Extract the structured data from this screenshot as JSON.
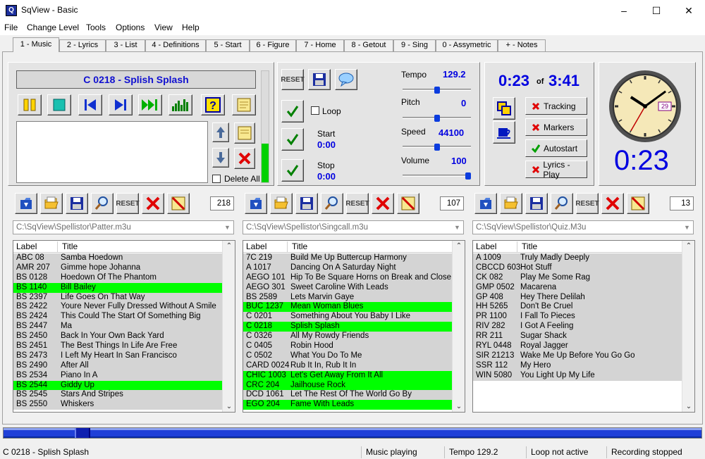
{
  "window": {
    "title": "SqView - Basic",
    "icon": "sqview-app-icon",
    "minimize": "–",
    "maximize": "☐",
    "close": "✕"
  },
  "menu": [
    "File",
    "Change Level",
    "Tools",
    "Options",
    "View",
    "Help"
  ],
  "tabs": [
    "1 - Music",
    "2 - Lyrics",
    "3 - List",
    "4 - Definitions",
    "5 - Start",
    "6 - Figure",
    "7 - Home",
    "8 - Getout",
    "9 - Sing",
    "0 - Assymetric",
    "+ - Notes"
  ],
  "player": {
    "song_title": "C 0218 - Splish Splash",
    "delete_all_label": "Delete All",
    "reset_label": "RESET",
    "loop_label": "Loop",
    "start_label": "Start",
    "start_value": "0:00",
    "stop_label": "Stop",
    "stop_value": "0:00",
    "level_fraction": 0.35
  },
  "controls": {
    "tempo_label": "Tempo",
    "tempo_value": "129.2",
    "tempo_fraction": 0.5,
    "pitch_label": "Pitch",
    "pitch_value": "0",
    "pitch_fraction": 0.5,
    "speed_label": "Speed",
    "speed_value": "44100",
    "speed_fraction": 0.5,
    "volume_label": "Volume",
    "volume_value": "100",
    "volume_fraction": 1.0
  },
  "time": {
    "elapsed": "0:23",
    "of": "of",
    "total": "3:41",
    "big_elapsed": "0:23",
    "clock_date": "29",
    "clock_hour": 10.1,
    "clock_minute": 9,
    "clock_second": 35
  },
  "side_buttons": {
    "tracking": "Tracking",
    "markers": "Markers",
    "autostart": "Autostart",
    "lyrics_play": "Lyrics - Play"
  },
  "lists": [
    {
      "count": "218",
      "path": "C:\\SqView\\Spellistor\\Patter.m3u",
      "col_label": "Label",
      "col_title": "Title",
      "rows": [
        {
          "label": "ABC 08",
          "title": "Samba Hoedown",
          "hl": false
        },
        {
          "label": "AMR 207",
          "title": "Gimme hope Johanna",
          "hl": false
        },
        {
          "label": "BS 0128",
          "title": "Hoedown Of The Phantom",
          "hl": false
        },
        {
          "label": "BS 1140",
          "title": "Bill Bailey",
          "hl": true
        },
        {
          "label": "BS 2397",
          "title": "Life Goes On That Way",
          "hl": false
        },
        {
          "label": "BS 2422",
          "title": "Youre Never Fully Dressed Without A Smile",
          "hl": false
        },
        {
          "label": "BS 2424",
          "title": "This Could The Start Of Something Big",
          "hl": false
        },
        {
          "label": "BS 2447",
          "title": "Ma",
          "hl": false
        },
        {
          "label": "BS 2450",
          "title": "Back In Your Own Back Yard",
          "hl": false
        },
        {
          "label": "BS 2451",
          "title": "The Best Things In Life Are Free",
          "hl": false
        },
        {
          "label": "BS 2473",
          "title": "I Left My Heart In San Francisco",
          "hl": false
        },
        {
          "label": "BS 2490",
          "title": "After All",
          "hl": false
        },
        {
          "label": "BS 2534",
          "title": "Piano In A",
          "hl": false
        },
        {
          "label": "BS 2544",
          "title": "Giddy Up",
          "hl": true
        },
        {
          "label": "BS 2545",
          "title": "Stars And Stripes",
          "hl": false
        },
        {
          "label": "BS 2550",
          "title": "Whiskers",
          "hl": false
        }
      ]
    },
    {
      "count": "107",
      "path": "C:\\SqView\\Spellistor\\Singcall.m3u",
      "col_label": "Label",
      "col_title": "Title",
      "rows": [
        {
          "label": "7C 219",
          "title": "Build Me Up Buttercup Harmony",
          "hl": false
        },
        {
          "label": "A 1017",
          "title": "Dancing On A Saturday Night",
          "hl": false
        },
        {
          "label": "AEGO 101",
          "title": "Hip To Be Square Horns on Break and Close",
          "hl": false
        },
        {
          "label": "AEGO 301",
          "title": "Sweet Caroline With Leads",
          "hl": false
        },
        {
          "label": "BS 2589",
          "title": "Lets Marvin Gaye",
          "hl": false
        },
        {
          "label": "BUC 1237",
          "title": "Mean Woman Blues",
          "hl": true
        },
        {
          "label": "C 0201",
          "title": "Something About You Baby I Like",
          "hl": false
        },
        {
          "label": "C 0218",
          "title": "Splish Splash",
          "hl": true
        },
        {
          "label": "C 0326",
          "title": "All My Rowdy Friends",
          "hl": false
        },
        {
          "label": "C 0405",
          "title": "Robin Hood",
          "hl": false
        },
        {
          "label": "C 0502",
          "title": "What You Do To Me",
          "hl": false
        },
        {
          "label": "CARD 0024",
          "title": "Rub It In, Rub It In",
          "hl": false
        },
        {
          "label": "CHIC 1003",
          "title": "Let's Get Away From It All",
          "hl": true
        },
        {
          "label": "CRC 204",
          "title": "Jailhouse Rock",
          "hl": true
        },
        {
          "label": "DCD 1061",
          "title": "Let The Rest Of The World Go By",
          "hl": false
        },
        {
          "label": "EGO 204",
          "title": "Fame With Leads",
          "hl": true
        }
      ]
    },
    {
      "count": "13",
      "path": "C:\\SqView\\Spellistor\\Quiz.M3u",
      "col_label": "Label",
      "col_title": "Title",
      "rows": [
        {
          "label": "A 1009",
          "title": "Truly Madly Deeply",
          "hl": false
        },
        {
          "label": "CBCCD 603",
          "title": "Hot Stuff",
          "hl": false
        },
        {
          "label": "CK 082",
          "title": "Play Me Some Rag",
          "hl": false
        },
        {
          "label": "GMP 0502",
          "title": "Macarena",
          "hl": false
        },
        {
          "label": "GP 408",
          "title": "Hey There Delilah",
          "hl": false
        },
        {
          "label": "HH 5265",
          "title": "Don't Be Cruel",
          "hl": false
        },
        {
          "label": "PR 1100",
          "title": "I Fall To Pieces",
          "hl": false
        },
        {
          "label": "RIV 282",
          "title": "I Got A Feeling",
          "hl": false
        },
        {
          "label": "RR 211",
          "title": "Sugar Shack",
          "hl": false
        },
        {
          "label": "RYL 0448",
          "title": "Royal Jagger",
          "hl": false
        },
        {
          "label": "SIR 21213",
          "title": "Wake Me Up Before You Go Go",
          "hl": false
        },
        {
          "label": "SSR 112",
          "title": "My Hero",
          "hl": false
        },
        {
          "label": "WIN 5080",
          "title": "You Light Up My Life",
          "hl": false
        }
      ]
    }
  ],
  "progress_fraction": 0.104,
  "status": {
    "song": "C 0218 - Splish Splash",
    "state": "Music playing",
    "tempo": "Tempo 129.2",
    "loop": "Loop not active",
    "recording": "Recording stopped"
  },
  "colors": {
    "highlight": "#00ff00",
    "accent_blue": "#0000e0",
    "progress": "#1f3ee0"
  }
}
